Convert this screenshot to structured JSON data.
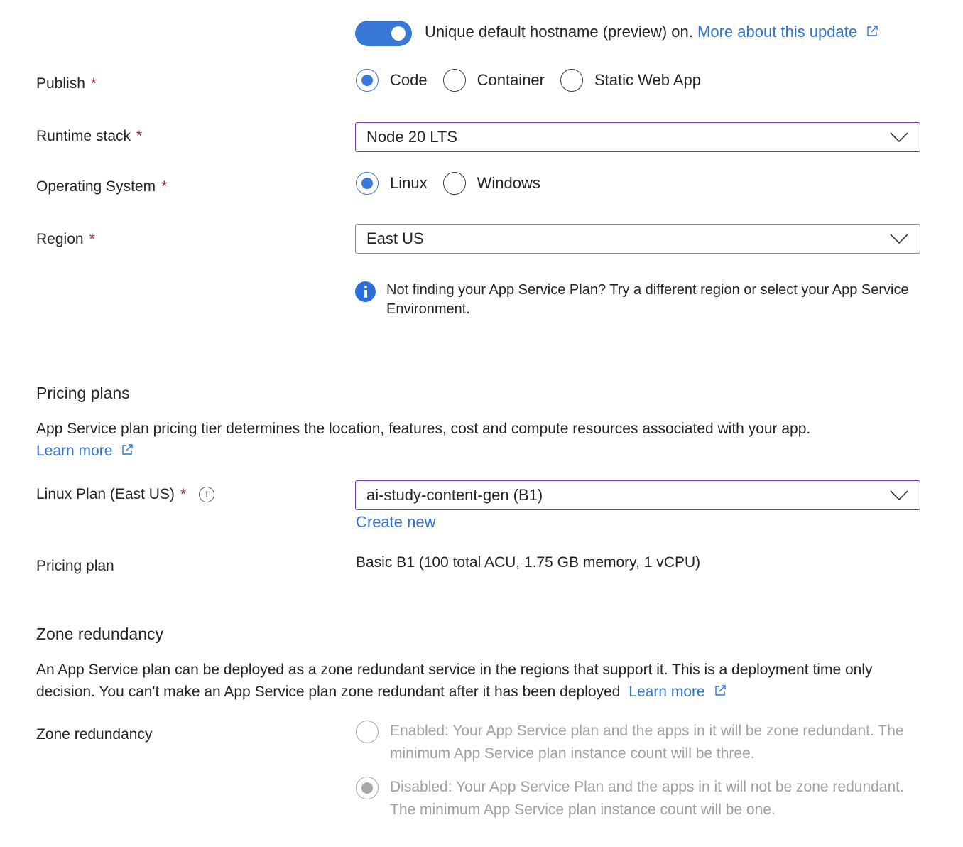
{
  "hostname": {
    "toggle_on": true,
    "text": "Unique default hostname (preview) on.",
    "link": "More about this update",
    "link_icon": "external-link-icon"
  },
  "publish": {
    "label": "Publish",
    "required": "*",
    "options": [
      {
        "label": "Code",
        "selected": true
      },
      {
        "label": "Container",
        "selected": false
      },
      {
        "label": "Static Web App",
        "selected": false
      }
    ]
  },
  "runtime": {
    "label": "Runtime stack",
    "required": "*",
    "value": "Node 20 LTS"
  },
  "os": {
    "label": "Operating System",
    "required": "*",
    "options": [
      {
        "label": "Linux",
        "selected": true
      },
      {
        "label": "Windows",
        "selected": false
      }
    ]
  },
  "region": {
    "label": "Region",
    "required": "*",
    "value": "East US",
    "info_icon": "info-icon",
    "info": "Not finding your App Service Plan? Try a different region or select your App Service Environment."
  },
  "pricing": {
    "title": "Pricing plans",
    "description": "App Service plan pricing tier determines the location, features, cost and compute resources associated with your app.",
    "learn_more": "Learn more",
    "plan_label": "Linux Plan (East US)",
    "plan_required": "*",
    "plan_info_glyph": "i",
    "plan_value": "ai-study-content-gen (B1)",
    "create_new": "Create new",
    "pricing_plan_label": "Pricing plan",
    "pricing_plan_value": "Basic B1 (100 total ACU, 1.75 GB memory, 1 vCPU)"
  },
  "zone": {
    "title": "Zone redundancy",
    "description": "An App Service plan can be deployed as a zone redundant service in the regions that support it. This is a deployment time only decision. You can't make an App Service plan zone redundant after it has been deployed",
    "learn_more": "Learn more",
    "label": "Zone redundancy",
    "options": [
      {
        "label": "Enabled: Your App Service plan and the apps in it will be zone redundant. The minimum App Service plan instance count will be three.",
        "selected": false,
        "disabled": true
      },
      {
        "label": "Disabled: Your App Service Plan and the apps in it will not be zone redundant. The minimum App Service plan instance count will be one.",
        "selected": true,
        "disabled": true
      }
    ]
  },
  "colors": {
    "accent": "#3a78d6",
    "link": "#2f74d0",
    "required": "#a4262c",
    "focus_border": "#7a3aa6",
    "disabled_text": "#a0a0a0"
  }
}
